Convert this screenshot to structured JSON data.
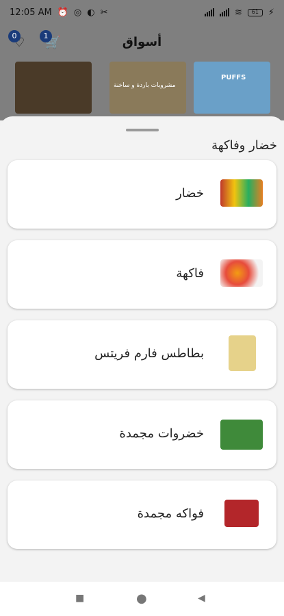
{
  "status": {
    "time": "12:05 AM",
    "battery_level": "61"
  },
  "app": {
    "title": "أسواق",
    "wishlist_count": "0",
    "cart_count": "1"
  },
  "banners": [
    {
      "name": "nuts-banner",
      "color": "#4a3a28"
    },
    {
      "name": "grocery-banner",
      "color": "#8a7a5a",
      "text": "مشروبات باردة و ساخنة"
    },
    {
      "name": "chips-banner",
      "color": "#6aa0c8",
      "text": "PUFFS"
    }
  ],
  "sheet": {
    "title": "خضار وفاكهة",
    "items": [
      {
        "label": "خضار",
        "thumb_color": "#b6402b"
      },
      {
        "label": "فاكهة",
        "thumb_color": "#e8c040"
      },
      {
        "label": "بطاطس فارم فريتس",
        "thumb_color": "#e6d28a"
      },
      {
        "label": "خضروات مجمدة",
        "thumb_color": "#3f8a3a"
      },
      {
        "label": "فواكه مجمدة",
        "thumb_color": "#b3262a"
      }
    ]
  },
  "navigation": {
    "recents": "■",
    "home": "●",
    "back": "◀"
  }
}
